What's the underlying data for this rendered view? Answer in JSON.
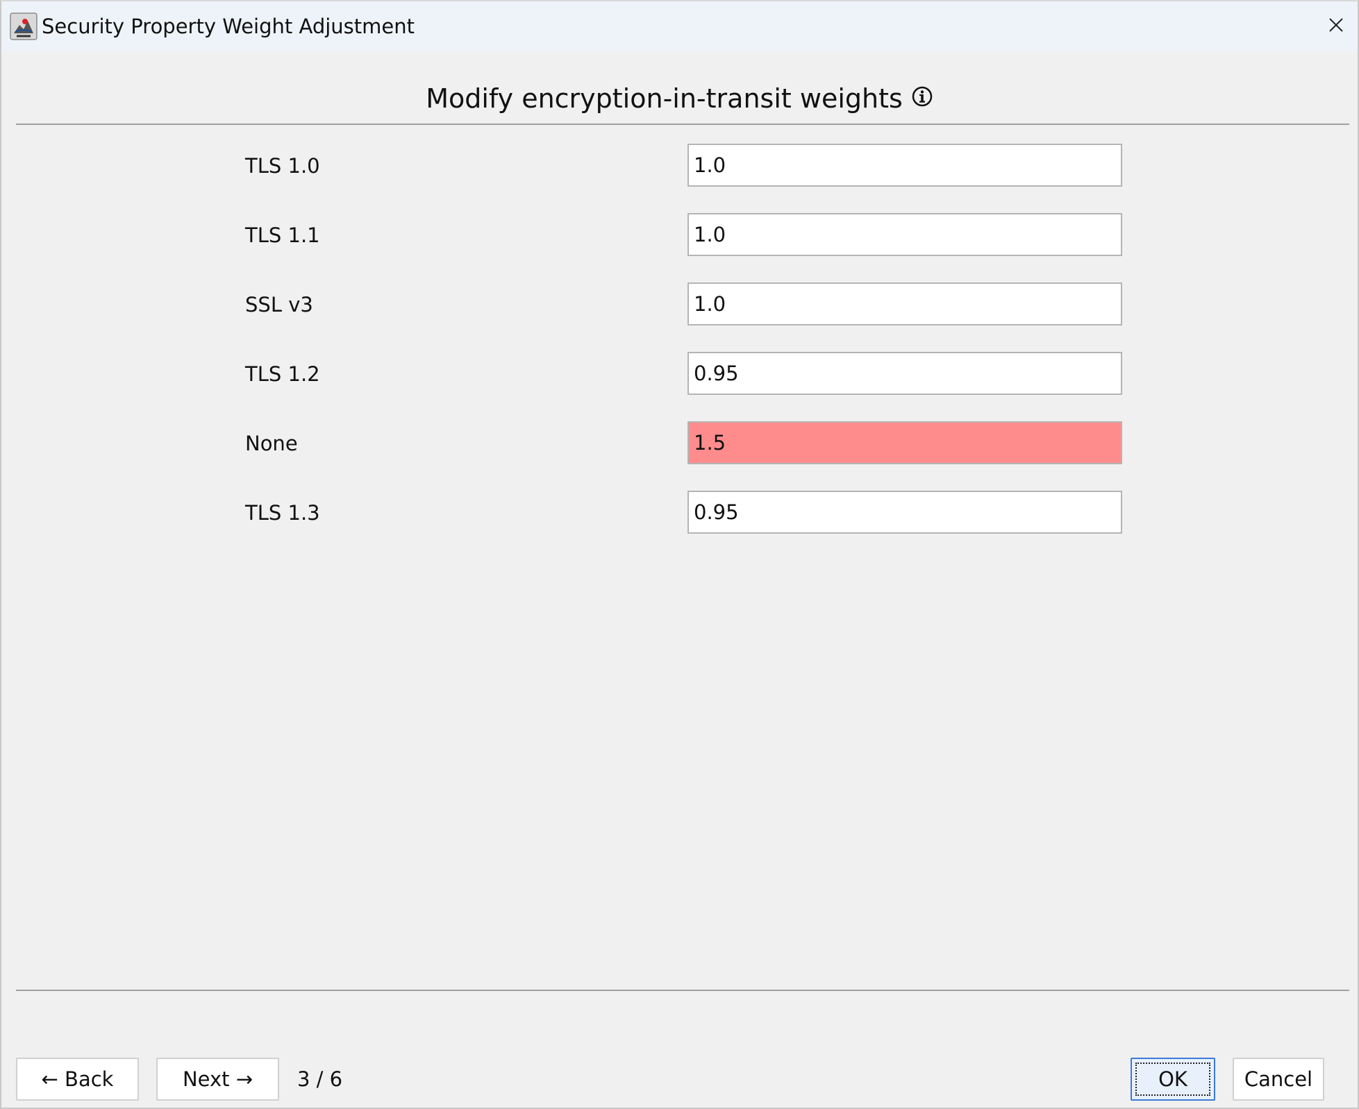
{
  "window": {
    "title": "Security Property Weight Adjustment",
    "app_icon": "java-cup-icon",
    "close_icon": "close-icon"
  },
  "heading": {
    "text": "Modify encryption-in-transit weights",
    "info_icon": "info-icon"
  },
  "rows": [
    {
      "label": "TLS 1.0",
      "value": "1.0",
      "invalid": false
    },
    {
      "label": "TLS 1.1",
      "value": "1.0",
      "invalid": false
    },
    {
      "label": "SSL v3",
      "value": "1.0",
      "invalid": false
    },
    {
      "label": "TLS 1.2",
      "value": "0.95",
      "invalid": false
    },
    {
      "label": "None",
      "value": "1.5",
      "invalid": true
    },
    {
      "label": "TLS 1.3",
      "value": "0.95",
      "invalid": false
    }
  ],
  "footer": {
    "back_label": "← Back",
    "next_label": "Next →",
    "page_counter": "3 / 6",
    "ok_label": "OK",
    "cancel_label": "Cancel"
  },
  "colors": {
    "invalid_field": "#ff8c8c",
    "titlebar": "#eef3f9",
    "background": "#f0f0f0",
    "default_button_border": "#3a7bd5"
  }
}
